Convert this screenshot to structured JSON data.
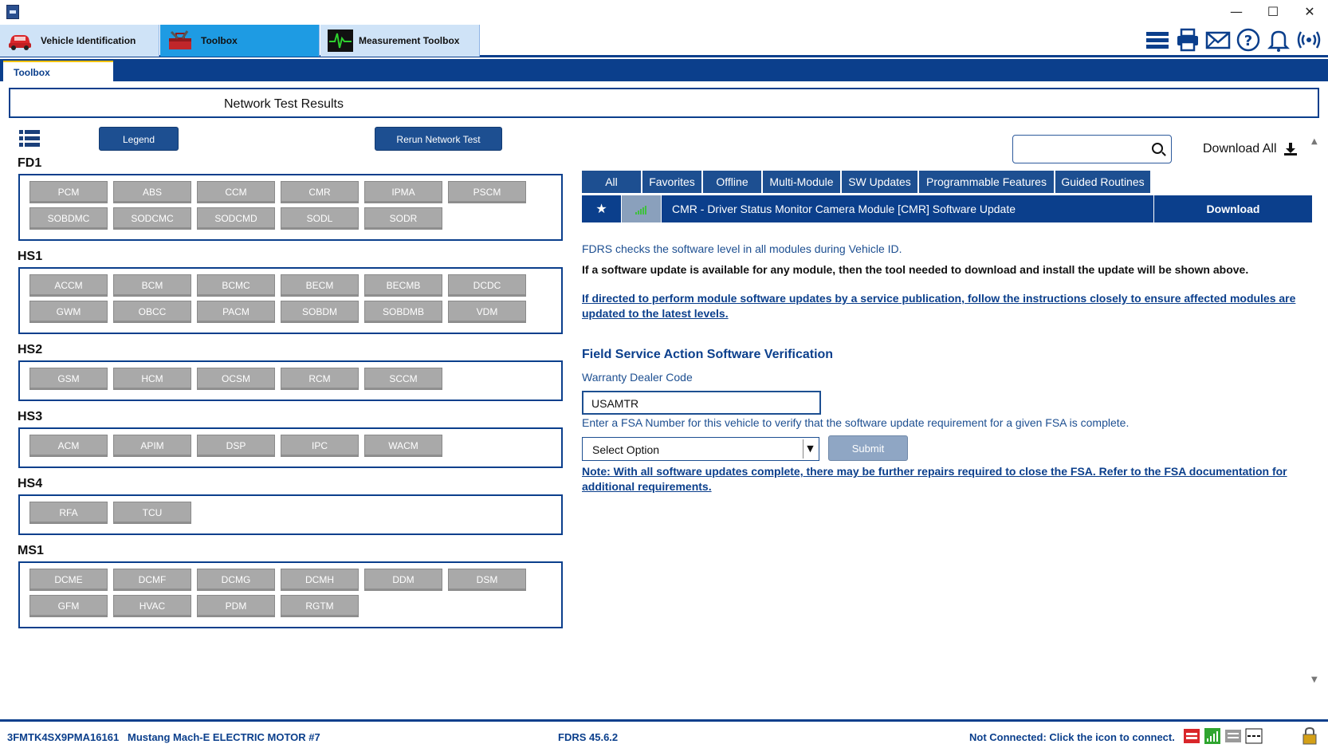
{
  "window": {
    "minimize": "—",
    "maximize": "☐",
    "close": "✕"
  },
  "main_tabs": [
    {
      "label": "Vehicle Identification",
      "icon": "car-icon"
    },
    {
      "label": "Toolbox",
      "icon": "toolbox-icon"
    },
    {
      "label": "Measurement Toolbox",
      "icon": "oscilloscope-icon"
    }
  ],
  "right_icons": [
    "menu-icon",
    "printer-icon",
    "mail-icon",
    "help-icon",
    "bell-icon",
    "broadcast-icon"
  ],
  "sub_tab": "Toolbox",
  "page_title": "Network Test Results",
  "buttons": {
    "legend": "Legend",
    "rerun": "Rerun Network Test",
    "submit": "Submit"
  },
  "buses": [
    {
      "name": "FD1",
      "modules": [
        "PCM",
        "ABS",
        "CCM",
        "CMR",
        "IPMA",
        "PSCM",
        "SOBDMC",
        "SODCMC",
        "SODCMD",
        "SODL",
        "SODR"
      ]
    },
    {
      "name": "HS1",
      "modules": [
        "ACCM",
        "BCM",
        "BCMC",
        "BECM",
        "BECMB",
        "DCDC",
        "GWM",
        "OBCC",
        "PACM",
        "SOBDM",
        "SOBDMB",
        "VDM"
      ]
    },
    {
      "name": "HS2",
      "modules": [
        "GSM",
        "HCM",
        "OCSM",
        "RCM",
        "SCCM"
      ]
    },
    {
      "name": "HS3",
      "modules": [
        "ACM",
        "APIM",
        "DSP",
        "IPC",
        "WACM"
      ]
    },
    {
      "name": "HS4",
      "modules": [
        "RFA",
        "TCU"
      ]
    },
    {
      "name": "MS1",
      "modules": [
        "DCME",
        "DCMF",
        "DCMG",
        "DCMH",
        "DDM",
        "DSM",
        "GFM",
        "HVAC",
        "PDM",
        "RGTM"
      ]
    }
  ],
  "search": {
    "placeholder": ""
  },
  "download_all": "Download All",
  "filter_tabs": [
    "All",
    "Favorites",
    "Offline",
    "Multi-Module",
    "SW Updates",
    "Programmable Features",
    "Guided Routines"
  ],
  "result": {
    "text": "CMR - Driver Status Monitor Camera Module [CMR] Software Update",
    "action": "Download",
    "star": "★"
  },
  "info": {
    "line1": "FDRS checks the software level in all modules during Vehicle ID.",
    "line2": "If a software update is available for any module, then the tool needed to download and install the update will be shown above.",
    "line3": "If directed to perform module software updates by a service publication, follow the instructions closely to ensure affected modules are updated to the latest levels."
  },
  "fsa": {
    "title": "Field Service Action Software Verification",
    "dealer_label": "Warranty Dealer Code",
    "dealer_value": "USAMTR",
    "instruction": "Enter a FSA Number for this vehicle to verify that the software update requirement for a given FSA is complete.",
    "select_value": "Select Option",
    "note": "Note: With all software updates complete, there may be further repairs required to close the FSA. Refer to the FSA documentation for additional requirements."
  },
  "status": {
    "vin": "3FMTK4SX9PMA16161",
    "vehicle": "Mustang Mach-E ELECTRIC MOTOR #7",
    "version": "FDRS 45.6.2",
    "connection": "Not Connected: Click the icon to connect."
  },
  "colors": {
    "primary": "#0b3f8c",
    "button": "#1d4f91",
    "module_gray": "#a9a9a9",
    "active_tab": "#1e9be3",
    "inactive_tab": "#cfe3f7"
  }
}
